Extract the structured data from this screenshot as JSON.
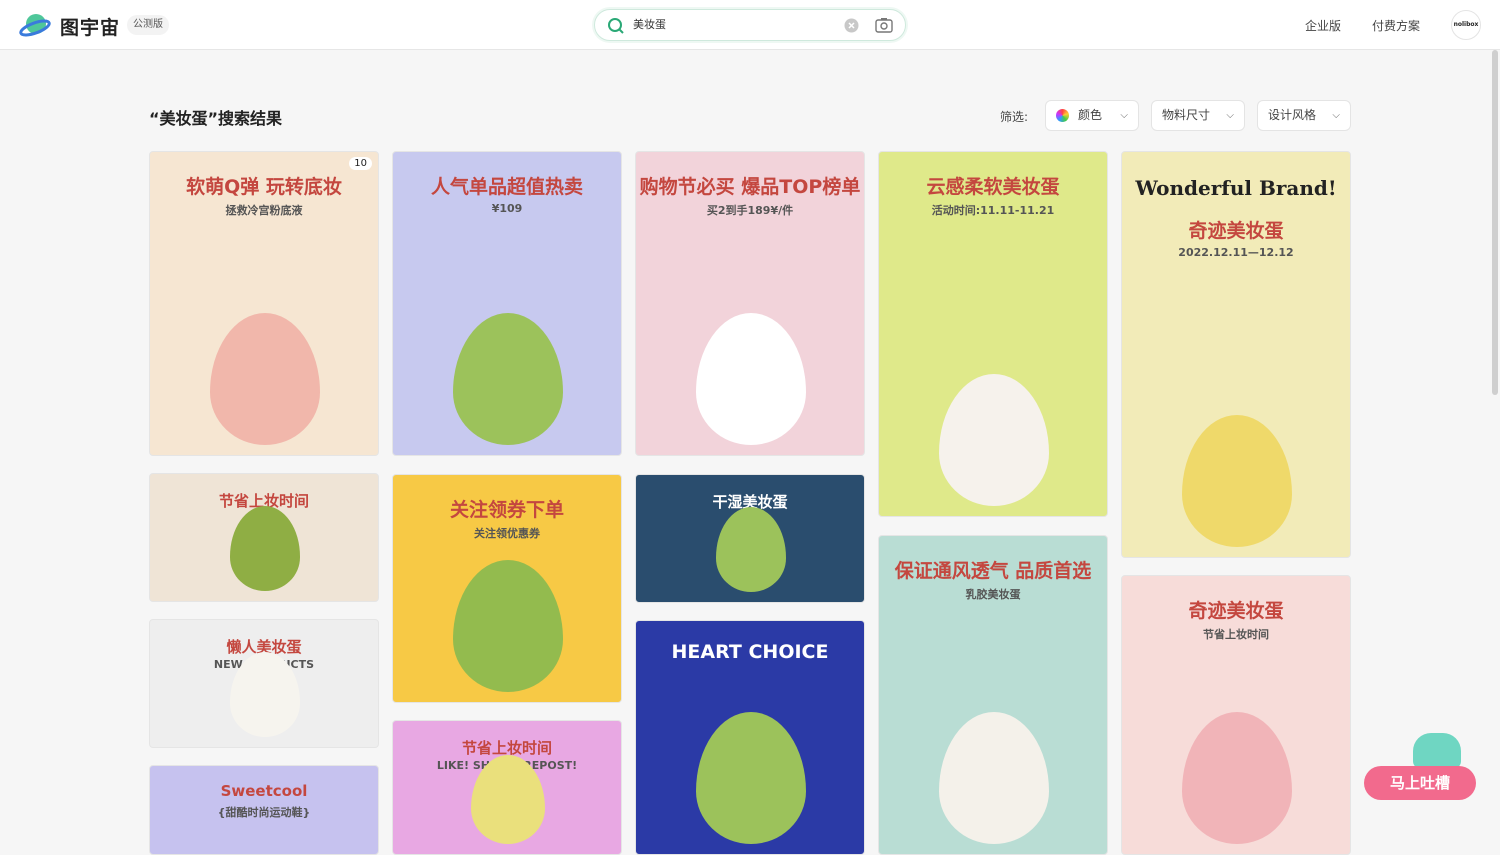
{
  "header": {
    "brand": "图宇宙",
    "badge": "公测版",
    "search_value": "美妆蛋",
    "nav": [
      "企业版",
      "付费方案"
    ],
    "avatar": "nolibox"
  },
  "results": {
    "title": "“美妆蛋”搜索结果",
    "filter_label": "筛选:",
    "filters": [
      "颜色",
      "物料尺寸",
      "设计风格"
    ]
  },
  "cards": [
    {
      "title": "软萌Q弹 玩转底妆",
      "sub": "拯救冷宫粉底液",
      "count": "10",
      "bg": "#f6e6d2",
      "egg": "#f1b7ab"
    },
    {
      "title": "人气单品超值热卖",
      "sub": "¥109",
      "bg": "#c7c9ef",
      "egg": "#9cc25b"
    },
    {
      "title": "购物节必买 爆品TOP榜单",
      "sub": "买2到手189¥/件",
      "bg": "#f2d3da",
      "egg": "#ffffff"
    },
    {
      "title": "云感柔软美妆蛋",
      "sub": "活动时间:11.11-11.21",
      "bg": "#dfe98a",
      "egg": "#f6f2ec"
    },
    {
      "title": "奇迹美妆蛋",
      "sub": "2022.12.11—12.12",
      "bg": "#f2ebb8",
      "egg": "#efd96a",
      "extra": "Wonderful Brand!"
    },
    {
      "title": "节省上妆时间",
      "sub": "",
      "bg": "#efe4d6",
      "egg": "#8fae44"
    },
    {
      "title": "关注领券下单",
      "sub": "关注领优惠券",
      "bg": "#f7c945",
      "egg": "#93bb4e"
    },
    {
      "title": "干湿美妆蛋",
      "sub": "",
      "bg": "#2a4d6e",
      "egg": "#9cc25b"
    },
    {
      "title": "保证通风透气 品质首选",
      "sub": "乳胶美妆蛋",
      "bg": "#b9ddd4",
      "egg": "#f4f1ea"
    },
    {
      "title": "奇迹美妆蛋",
      "sub": "节省上妆时间",
      "bg": "#f7dcd9",
      "egg": "#f1b4b8"
    },
    {
      "title": "懒人美妆蛋",
      "sub": "NEW PRODUCTS",
      "bg": "#eeeeee",
      "egg": "#f6f4ee"
    },
    {
      "title": "节省上妆时间",
      "sub": "LIKE! SHARE! REPOST!",
      "bg": "#e8a8e3",
      "egg": "#eae07c"
    },
    {
      "title": "HEART CHOICE",
      "sub": "",
      "bg": "#2b3aa6",
      "egg": "#9cc25b"
    },
    {
      "title": "Sweetcool",
      "sub": "{甜酷时尚运动鞋}",
      "bg": "#c6c2ef",
      "egg": "#c6c2ef"
    }
  ],
  "feedback": "马上吐槽"
}
